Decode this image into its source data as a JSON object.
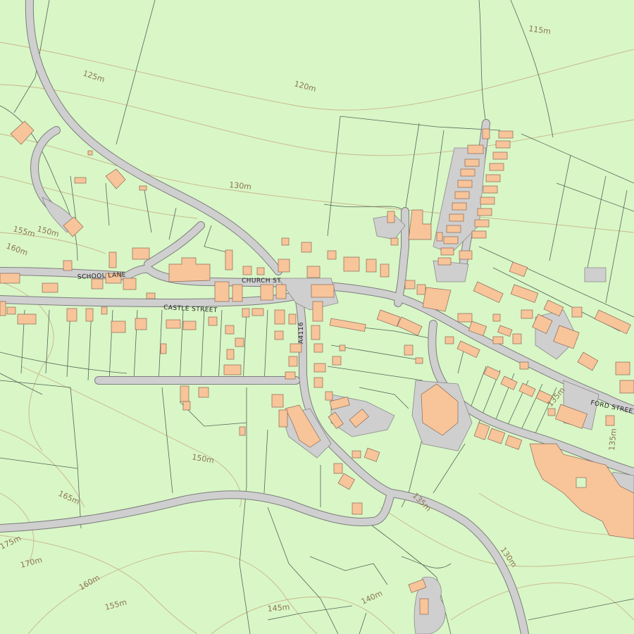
{
  "map": {
    "colors": {
      "background": "#d9f6c6",
      "building": "#f8c49a",
      "road": "#cfcfcf",
      "contour": "#c8b68a",
      "field_boundary": "#55655a"
    },
    "street_labels": {
      "school_lane": "SCHOOL LANE",
      "church_st": "CHURCH ST",
      "castle_street": "CASTLE STREET",
      "ford_street": "FORD STREET",
      "a4116": "A4116"
    },
    "contour_labels": {
      "c115": "115m",
      "c120": "120m",
      "c125": "125m",
      "c130": "130m",
      "c155": "155m",
      "c150": "150m",
      "c160": "160m",
      "c150b": "150m",
      "c165": "165m",
      "c175": "175m",
      "c170": "170m",
      "c160b": "160m",
      "c155b": "155m",
      "c145": "145m",
      "c140": "140m",
      "c135": "135m",
      "c130b": "130m",
      "c135b": "135m",
      "c136": "135m"
    }
  }
}
